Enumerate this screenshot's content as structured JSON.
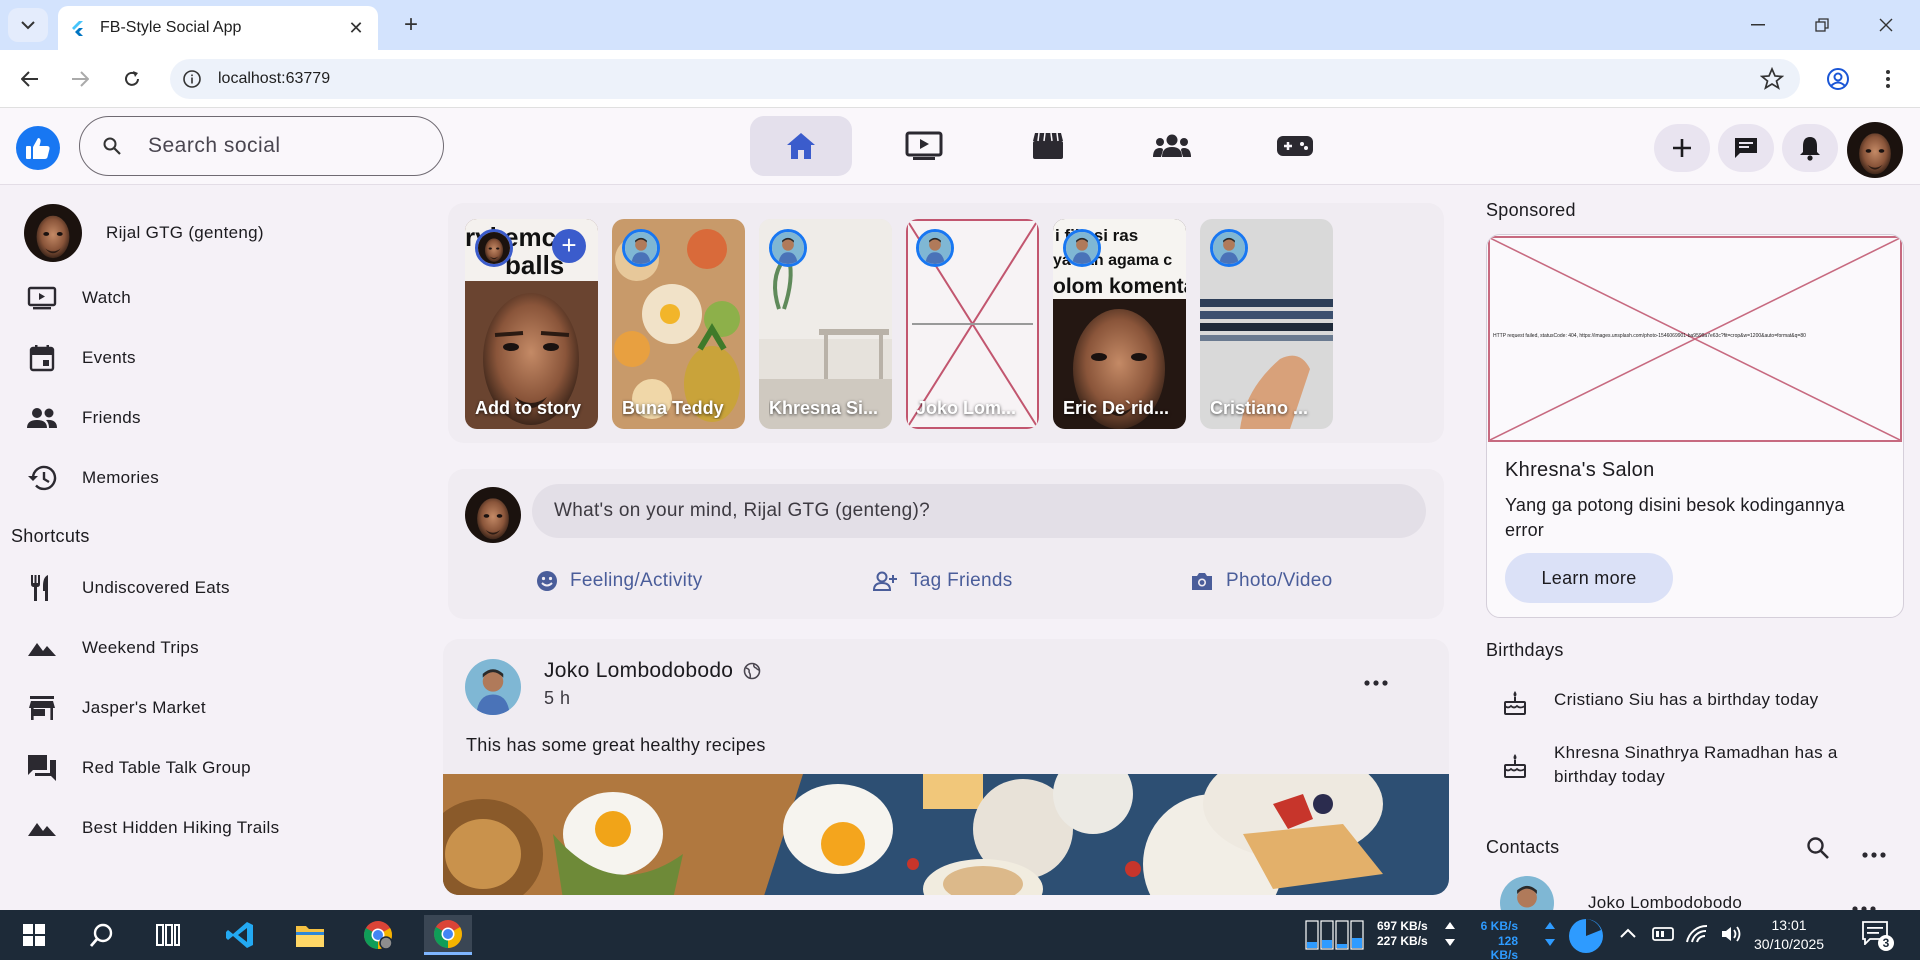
{
  "browser": {
    "tab_title": "FB-Style Social App",
    "url": "localhost:63779",
    "new_tab": "+",
    "close_tab": "✕"
  },
  "header": {
    "search_placeholder": "Search social",
    "nav": [
      "home-icon",
      "video-icon",
      "marketplace-icon",
      "groups-icon",
      "gaming-icon"
    ],
    "actions": [
      "add-icon",
      "messenger-icon",
      "notifications-icon"
    ]
  },
  "sidebar": {
    "user": "Rijal GTG (genteng)",
    "items": [
      {
        "label": "Watch",
        "icon": "watch-icon"
      },
      {
        "label": "Events",
        "icon": "calendar-icon"
      },
      {
        "label": "Friends",
        "icon": "friends-icon"
      },
      {
        "label": "Memories",
        "icon": "history-icon"
      }
    ],
    "shortcuts_title": "Shortcuts",
    "shortcuts": [
      {
        "label": "Undiscovered Eats",
        "icon": "restaurant-icon"
      },
      {
        "label": "Weekend Trips",
        "icon": "landscape-icon"
      },
      {
        "label": "Jasper's Market",
        "icon": "store-icon"
      },
      {
        "label": "Red Table Talk Group",
        "icon": "forum-icon"
      },
      {
        "label": "Best Hidden Hiking Trails",
        "icon": "landscape-icon"
      }
    ]
  },
  "stories": [
    {
      "name": "Add to story",
      "overlay": "ryi emc balls"
    },
    {
      "name": "Buna Teddy"
    },
    {
      "name": "Khresna Si..."
    },
    {
      "name": "Joko Lom..."
    },
    {
      "name": "Eric De`rid...",
      "overlay": "i fikasi ras ya dan agama c olom komenta"
    },
    {
      "name": "Cristiano ..."
    }
  ],
  "composer": {
    "prompt": "What's on your mind, Rijal GTG (genteng)?",
    "actions": [
      "Feeling/Activity",
      "Tag Friends",
      "Photo/Video"
    ]
  },
  "post": {
    "author": "Joko Lombodobodo",
    "time": "5 h",
    "text": "This has some great healthy recipes"
  },
  "right": {
    "sponsored_title": "Sponsored",
    "ad_error_text": "HTTP request failed, statusCode: 404, https://images.unsplash.com/photo-1546069901-ba9599a7e63c?fit=crop&w=1200&auto=format&q=80",
    "ad_brand": "Khresna's Salon",
    "ad_desc": "Yang ga potong disini besok kodingannya error",
    "ad_cta": "Learn more",
    "birthdays_title": "Birthdays",
    "birthdays": [
      "Cristiano Siu has a birthday today",
      "Khresna Sinathrya Ramadhan has a birthday today"
    ],
    "contacts_title": "Contacts",
    "contact_name": "Joko Lombodobodo"
  },
  "taskbar": {
    "net_up": "697 KB/s",
    "net_down": "227 KB/s",
    "net2_up": "6 KB/s",
    "net2_down": "128 KB/s",
    "time": "13:01",
    "date": "30/10/2025",
    "notifications": "3"
  }
}
